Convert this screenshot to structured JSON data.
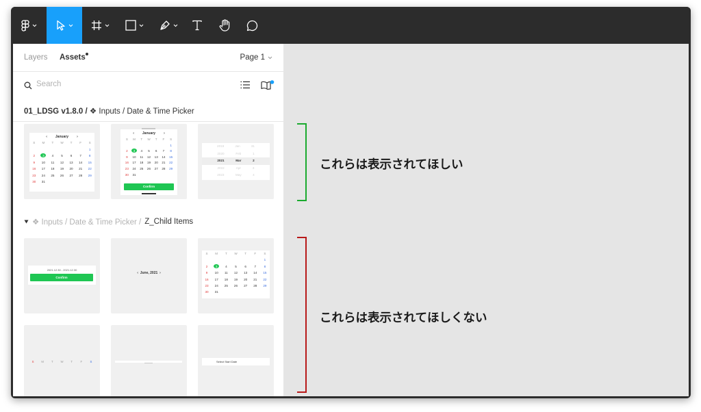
{
  "toolbar": {
    "tools": [
      {
        "name": "figma-menu",
        "icon": "figma-logo-icon",
        "caret": true,
        "active": false
      },
      {
        "name": "move-tool",
        "icon": "cursor-arrow-icon",
        "caret": true,
        "active": true
      },
      {
        "name": "frame-tool",
        "icon": "frame-hash-icon",
        "caret": true,
        "active": false
      },
      {
        "name": "shape-tool",
        "icon": "rectangle-icon",
        "caret": true,
        "active": false
      },
      {
        "name": "pen-tool",
        "icon": "pen-nib-icon",
        "caret": true,
        "active": false
      },
      {
        "name": "text-tool",
        "icon": "text-t-icon",
        "caret": false,
        "active": false
      },
      {
        "name": "hand-tool",
        "icon": "hand-icon",
        "caret": false,
        "active": false
      },
      {
        "name": "comment-tool",
        "icon": "speech-bubble-icon",
        "caret": false,
        "active": false
      }
    ],
    "active_color": "#18a0fb"
  },
  "sidebar": {
    "tabs": {
      "layers": "Layers",
      "assets": "Assets"
    },
    "page_selector": "Page 1",
    "search": {
      "placeholder": "Search"
    },
    "library_path": {
      "library": "01_LDSG v1.8.0 /",
      "component_glyph": "❖",
      "path": "Inputs / Date & Time Picker"
    },
    "group_path": {
      "prefix": "❖ Inputs / Date & Time Picker /",
      "name": "Z_Child Items"
    }
  },
  "thumbnails": {
    "calendar": {
      "month": "January",
      "weekdays": [
        "S",
        "M",
        "T",
        "W",
        "T",
        "F",
        "S"
      ],
      "days": [
        "",
        "",
        "",
        "",
        "",
        "",
        "1",
        "2",
        "3",
        "4",
        "5",
        "6",
        "7",
        "8",
        "9",
        "10",
        "11",
        "12",
        "13",
        "14",
        "15",
        "16",
        "17",
        "18",
        "19",
        "20",
        "21",
        "22",
        "23",
        "24",
        "25",
        "26",
        "27",
        "28",
        "29",
        "30",
        "31",
        "",
        "",
        "",
        "",
        ""
      ],
      "selected_day": "3"
    },
    "confirm_label": "Confirm",
    "date_range": "2021.12.30 - 2021.12.30",
    "picker_rows": [
      {
        "year": "2019",
        "month": "Jan",
        "day": "31"
      },
      {
        "year": "2020",
        "month": "Feb",
        "day": "1"
      },
      {
        "year": "2021",
        "month": "Mar",
        "day": "2"
      },
      {
        "year": "2022",
        "month": "Apr",
        "day": "3"
      },
      {
        "year": "2023",
        "month": "May",
        "day": "4"
      }
    ],
    "month_nav_label": "June, 2021",
    "start_date_label": "Select Start Date"
  },
  "annotations": {
    "show": {
      "text": "これらは表示されてほしい",
      "color": "#1aaa2e"
    },
    "hide": {
      "text": "これらは表示されてほしくない",
      "color": "#b81818"
    }
  },
  "colors": {
    "accent_green": "#1fc653",
    "canvas_bg": "#e5e5e5",
    "toolbar_bg": "#2c2c2c"
  }
}
